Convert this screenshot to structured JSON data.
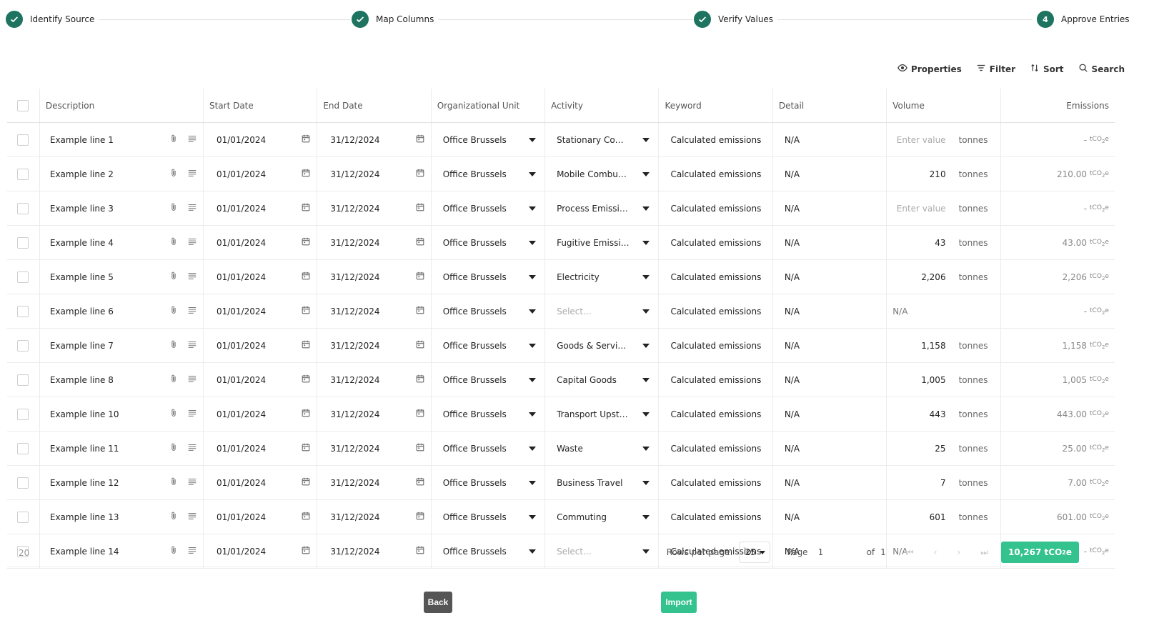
{
  "stepper": {
    "steps": [
      {
        "label": "Identify Source",
        "state": "done"
      },
      {
        "label": "Map Columns",
        "state": "done"
      },
      {
        "label": "Verify Values",
        "state": "done"
      },
      {
        "label": "Approve Entries",
        "state": "current",
        "number": "4"
      }
    ],
    "color_done": "#1e7460"
  },
  "toolbar": {
    "properties": "Properties",
    "filter": "Filter",
    "sort": "Sort",
    "search": "Search"
  },
  "table": {
    "headers": {
      "description": "Description",
      "start_date": "Start Date",
      "end_date": "End Date",
      "org_unit": "Organizational Unit",
      "activity": "Activity",
      "keyword": "Keyword",
      "detail": "Detail",
      "volume": "Volume",
      "emissions": "Emissions"
    },
    "emission_unit": "tCO",
    "emission_unit_sub": "2",
    "emission_unit_suffix": "e",
    "rows": [
      {
        "desc": "Example line 1",
        "start": "01/01/2024",
        "end": "31/12/2024",
        "org": "Office Brussels",
        "activity": "Stationary Combus...",
        "activity_placeholder": false,
        "keyword": "Calculated emissions",
        "detail": "N/A",
        "volume": "Enter value",
        "volume_placeholder": true,
        "unit": "tonnes",
        "emissions": "-"
      },
      {
        "desc": "Example line 2",
        "start": "01/01/2024",
        "end": "31/12/2024",
        "org": "Office Brussels",
        "activity": "Mobile Combustion",
        "activity_placeholder": false,
        "keyword": "Calculated emissions",
        "detail": "N/A",
        "volume": "210",
        "volume_placeholder": false,
        "unit": "tonnes",
        "emissions": "210.00"
      },
      {
        "desc": "Example line 3",
        "start": "01/01/2024",
        "end": "31/12/2024",
        "org": "Office Brussels",
        "activity": "Process Emissions",
        "activity_placeholder": false,
        "keyword": "Calculated emissions",
        "detail": "N/A",
        "volume": "Enter value",
        "volume_placeholder": true,
        "unit": "tonnes",
        "emissions": "-"
      },
      {
        "desc": "Example line 4",
        "start": "01/01/2024",
        "end": "31/12/2024",
        "org": "Office Brussels",
        "activity": "Fugitive Emissions",
        "activity_placeholder": false,
        "keyword": "Calculated emissions",
        "detail": "N/A",
        "volume": "43",
        "volume_placeholder": false,
        "unit": "tonnes",
        "emissions": "43.00"
      },
      {
        "desc": "Example line 5",
        "start": "01/01/2024",
        "end": "31/12/2024",
        "org": "Office Brussels",
        "activity": "Electricity",
        "activity_placeholder": false,
        "keyword": "Calculated emissions",
        "detail": "N/A",
        "volume": "2,206",
        "volume_placeholder": false,
        "unit": "tonnes",
        "emissions": "2,206"
      },
      {
        "desc": "Example line 6",
        "start": "01/01/2024",
        "end": "31/12/2024",
        "org": "Office Brussels",
        "activity": "Select...",
        "activity_placeholder": true,
        "keyword": "Calculated emissions",
        "detail": "N/A",
        "volume": "N/A",
        "volume_na": true,
        "unit": "",
        "emissions": "-"
      },
      {
        "desc": "Example line 7",
        "start": "01/01/2024",
        "end": "31/12/2024",
        "org": "Office Brussels",
        "activity": "Goods & Services",
        "activity_placeholder": false,
        "keyword": "Calculated emissions",
        "detail": "N/A",
        "volume": "1,158",
        "volume_placeholder": false,
        "unit": "tonnes",
        "emissions": "1,158"
      },
      {
        "desc": "Example line 8",
        "start": "01/01/2024",
        "end": "31/12/2024",
        "org": "Office Brussels",
        "activity": "Capital Goods",
        "activity_placeholder": false,
        "keyword": "Calculated emissions",
        "detail": "N/A",
        "volume": "1,005",
        "volume_placeholder": false,
        "unit": "tonnes",
        "emissions": "1,005"
      },
      {
        "desc": "Example line 10",
        "start": "01/01/2024",
        "end": "31/12/2024",
        "org": "Office Brussels",
        "activity": "Transport Upstream",
        "activity_placeholder": false,
        "keyword": "Calculated emissions",
        "detail": "N/A",
        "volume": "443",
        "volume_placeholder": false,
        "unit": "tonnes",
        "emissions": "443.00"
      },
      {
        "desc": "Example line 11",
        "start": "01/01/2024",
        "end": "31/12/2024",
        "org": "Office Brussels",
        "activity": "Waste",
        "activity_placeholder": false,
        "keyword": "Calculated emissions",
        "detail": "N/A",
        "volume": "25",
        "volume_placeholder": false,
        "unit": "tonnes",
        "emissions": "25.00"
      },
      {
        "desc": "Example line 12",
        "start": "01/01/2024",
        "end": "31/12/2024",
        "org": "Office Brussels",
        "activity": "Business Travel",
        "activity_placeholder": false,
        "keyword": "Calculated emissions",
        "detail": "N/A",
        "volume": "7",
        "volume_placeholder": false,
        "unit": "tonnes",
        "emissions": "7.00"
      },
      {
        "desc": "Example line 13",
        "start": "01/01/2024",
        "end": "31/12/2024",
        "org": "Office Brussels",
        "activity": "Commuting",
        "activity_placeholder": false,
        "keyword": "Calculated emissions",
        "detail": "N/A",
        "volume": "601",
        "volume_placeholder": false,
        "unit": "tonnes",
        "emissions": "601.00"
      },
      {
        "desc": "Example line 14",
        "start": "01/01/2024",
        "end": "31/12/2024",
        "org": "Office Brussels",
        "activity": "Select...",
        "activity_placeholder": true,
        "keyword": "Calculated emissions",
        "detail": "N/A",
        "volume": "N/A",
        "volume_na": true,
        "unit": "",
        "emissions": "-"
      }
    ]
  },
  "footer": {
    "count": "20",
    "rows_per_page_label": "Rows per page:",
    "rows_per_page": "25",
    "page_label": "Page",
    "page": "1",
    "of_label": "of",
    "of_total": "1",
    "total": "10,267 tCO",
    "total_sub": "2",
    "total_suffix": "e",
    "accent": "#34c38f"
  },
  "actions": {
    "back": "Back",
    "import": "Import"
  }
}
